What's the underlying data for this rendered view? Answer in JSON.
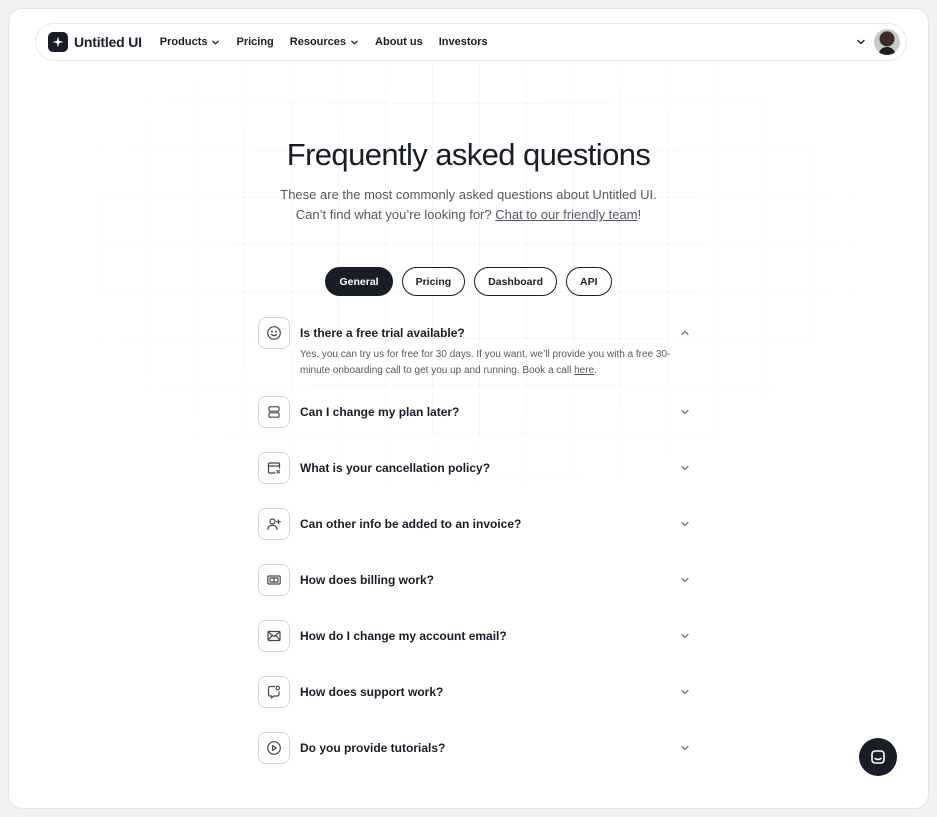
{
  "nav": {
    "brand": "Untitled UI",
    "links": [
      {
        "label": "Products",
        "has_dropdown": true
      },
      {
        "label": "Pricing",
        "has_dropdown": false
      },
      {
        "label": "Resources",
        "has_dropdown": true
      },
      {
        "label": "About us",
        "has_dropdown": false
      },
      {
        "label": "Investors",
        "has_dropdown": false
      }
    ]
  },
  "hero": {
    "title": "Frequently asked questions",
    "subtitle_line1": "These are the most commonly asked questions about Untitled UI.",
    "subtitle_line2_prefix": "Can’t find what you’re looking for? ",
    "subtitle_link": "Chat to our friendly team",
    "subtitle_line2_suffix": "!"
  },
  "tabs": [
    {
      "label": "General",
      "active": true
    },
    {
      "label": "Pricing",
      "active": false
    },
    {
      "label": "Dashboard",
      "active": false
    },
    {
      "label": "API",
      "active": false
    }
  ],
  "faq": [
    {
      "question": "Is there a free trial available?",
      "icon": "smile-icon",
      "open": true,
      "answer_text": "Yes, you can try us for free for 30 days. If you want, we’ll provide you with a free 30-minute onboarding call to get you up and running. Book a call ",
      "answer_link": "here",
      "answer_end": "."
    },
    {
      "question": "Can I change my plan later?",
      "icon": "layers-icon",
      "open": false
    },
    {
      "question": "What is your cancellation policy?",
      "icon": "calendar-x-icon",
      "open": false
    },
    {
      "question": "Can other info be added to an invoice?",
      "icon": "user-plus-icon",
      "open": false
    },
    {
      "question": "How does billing work?",
      "icon": "banknote-icon",
      "open": false
    },
    {
      "question": "How do I change my account email?",
      "icon": "mail-icon",
      "open": false
    },
    {
      "question": "How does support work?",
      "icon": "message-chat-icon",
      "open": false
    },
    {
      "question": "Do you provide tutorials?",
      "icon": "play-circle-icon",
      "open": false
    }
  ],
  "colors": {
    "primary": "#181d27",
    "text_secondary": "#535862",
    "border": "#d5d7da"
  }
}
